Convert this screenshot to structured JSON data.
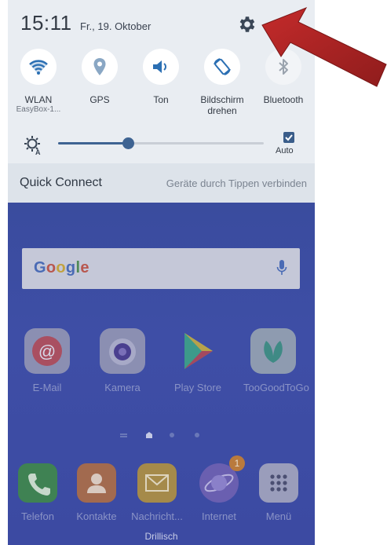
{
  "status": {
    "time": "15:11",
    "date": "Fr., 19. Oktober"
  },
  "quick_toggles": [
    {
      "label": "WLAN",
      "sub": "EasyBox-1...",
      "icon": "wifi-icon",
      "state": "on"
    },
    {
      "label": "GPS",
      "sub": "",
      "icon": "location-pin-icon",
      "state": "on"
    },
    {
      "label": "Ton",
      "sub": "",
      "icon": "volume-icon",
      "state": "on"
    },
    {
      "label": "Bildschirm drehen",
      "sub": "",
      "icon": "rotate-screen-icon",
      "state": "on"
    },
    {
      "label": "Bluetooth",
      "sub": "",
      "icon": "bluetooth-icon",
      "state": "off"
    }
  ],
  "brightness": {
    "level_percent": 34,
    "auto_label": "Auto",
    "auto_checked": true
  },
  "quick_connect": {
    "title": "Quick Connect",
    "hint": "Geräte durch Tippen verbinden"
  },
  "google_search": {
    "logo": "Google"
  },
  "home_apps": [
    {
      "label": "E-Mail",
      "icon": "email-icon"
    },
    {
      "label": "Kamera",
      "icon": "camera-icon"
    },
    {
      "label": "Play Store",
      "icon": "play-store-icon"
    },
    {
      "label": "TooGoodToGo",
      "icon": "toogoodtogo-icon"
    }
  ],
  "dock_apps": [
    {
      "label": "Telefon",
      "icon": "phone-icon"
    },
    {
      "label": "Kontakte",
      "icon": "contacts-icon"
    },
    {
      "label": "Nachricht...",
      "icon": "messages-icon"
    },
    {
      "label": "Internet",
      "icon": "internet-icon",
      "badge": "1"
    },
    {
      "label": "Menü",
      "icon": "apps-menu-icon"
    }
  ],
  "carrier": "Drillisch",
  "colors": {
    "shade_bg": "#e9edf2",
    "accent": "#3e6392",
    "home_bg": "#3a4ca0",
    "arrow": "#b02323"
  }
}
